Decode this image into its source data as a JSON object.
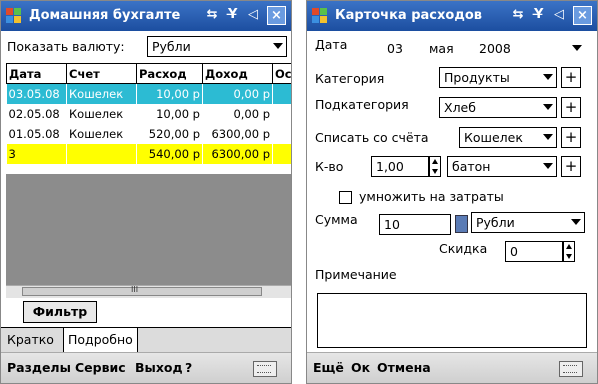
{
  "left": {
    "title": "Домашняя бухгалте",
    "sys_icons": "⇆ Y̶ ◁",
    "close": "×",
    "currency_label": "Показать валюту:",
    "currency_value": "Рубли",
    "columns": [
      "Дата",
      "Счет",
      "Расход",
      "Доход",
      "Ос"
    ],
    "rows": [
      {
        "date": "03.05.08",
        "account": "Кошелек",
        "expense": "10,00 р",
        "income": "0,00 р",
        "rest": ""
      },
      {
        "date": "02.05.08",
        "account": "Кошелек",
        "expense": "10,00 р",
        "income": "0,00 р",
        "rest": ""
      },
      {
        "date": "01.05.08",
        "account": "Кошелек",
        "expense": "520,00 р",
        "income": "6300,00 р",
        "rest": ""
      }
    ],
    "total_row": {
      "date": "3",
      "account": "",
      "expense": "540,00 р",
      "income": "6300,00 р",
      "rest": ""
    },
    "scroll_mark": "III",
    "filter_button": "Фильтр",
    "tabs": [
      "Кратко",
      "Подробно"
    ],
    "menu": {
      "sections": "Разделы",
      "service": "Сервис",
      "exit": "Выход",
      "help": "?"
    }
  },
  "right": {
    "title": "Карточка расходов",
    "sys_icons": "⇆ Y̶ ◁",
    "close": "×",
    "date_label": "Дата",
    "date_day": "03",
    "date_month": "мая",
    "date_year": "2008",
    "category_label": "Категория",
    "category_value": "Продукты",
    "subcategory_label": "Подкатегория",
    "subcategory_value": "Хлеб",
    "account_label": "Списать со счёта",
    "account_value": "Кошелек",
    "qty_label": "К-во",
    "qty_value": "1,00",
    "unit_value": "батон",
    "multiply_label": "умножить на затраты",
    "sum_label": "Сумма",
    "sum_value": "10",
    "sum_currency": "Рубли",
    "discount_label": "Скидка",
    "discount_value": "0",
    "note_label": "Примечание",
    "plus": "+",
    "menu": {
      "more": "Ещё",
      "ok": "Ок",
      "cancel": "Отмена"
    }
  },
  "colors": {
    "titlebar": "#1c4ea0",
    "selected_row": "#2cbbd3",
    "total_row": "#ffff00",
    "empty_grid": "#8c8c8c"
  }
}
